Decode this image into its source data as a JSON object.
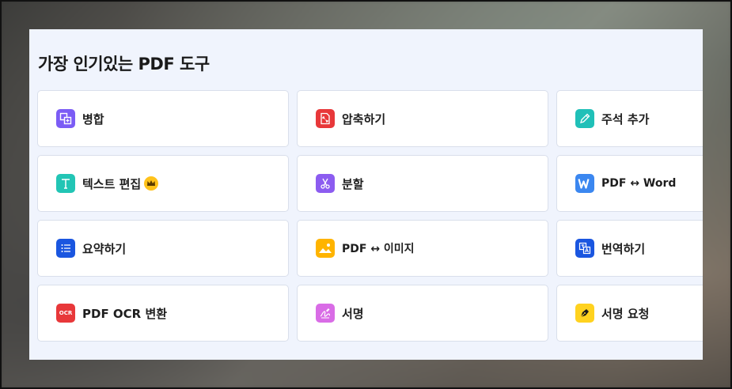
{
  "section_title": "가장 인기있는 PDF 도구",
  "tools": [
    {
      "label": "병합",
      "icon": "merge-icon",
      "color": "#7b5cf5"
    },
    {
      "label": "압축하기",
      "icon": "compress-icon",
      "color": "#e8383a"
    },
    {
      "label": "주석 추가",
      "icon": "annotate-pencil-icon",
      "color": "#20c0b8"
    },
    {
      "label": "텍스트 편집",
      "icon": "text-edit-icon",
      "color": "#22c5b5",
      "premium_icon": "crown-icon"
    },
    {
      "label": "분할",
      "icon": "scissors-icon",
      "color": "#8c5cf0"
    },
    {
      "label": "PDF ↔ Word",
      "icon": "word-icon",
      "color": "#3b87f0"
    },
    {
      "label": "요약하기",
      "icon": "list-summary-icon",
      "color": "#1a56e0"
    },
    {
      "label": "PDF ↔ 이미지",
      "icon": "image-icon",
      "color": "#ffb400"
    },
    {
      "label": "번역하기",
      "icon": "translate-icon",
      "color": "#1a56e0"
    },
    {
      "label": "PDF OCR 변환",
      "icon": "ocr-icon",
      "color": "#e8383a",
      "icon_text": "OCR"
    },
    {
      "label": "서명",
      "icon": "signature-icon",
      "color": "#d96ce6"
    },
    {
      "label": "서명 요청",
      "icon": "sign-request-pen-icon",
      "color": "#ffd21f"
    }
  ]
}
